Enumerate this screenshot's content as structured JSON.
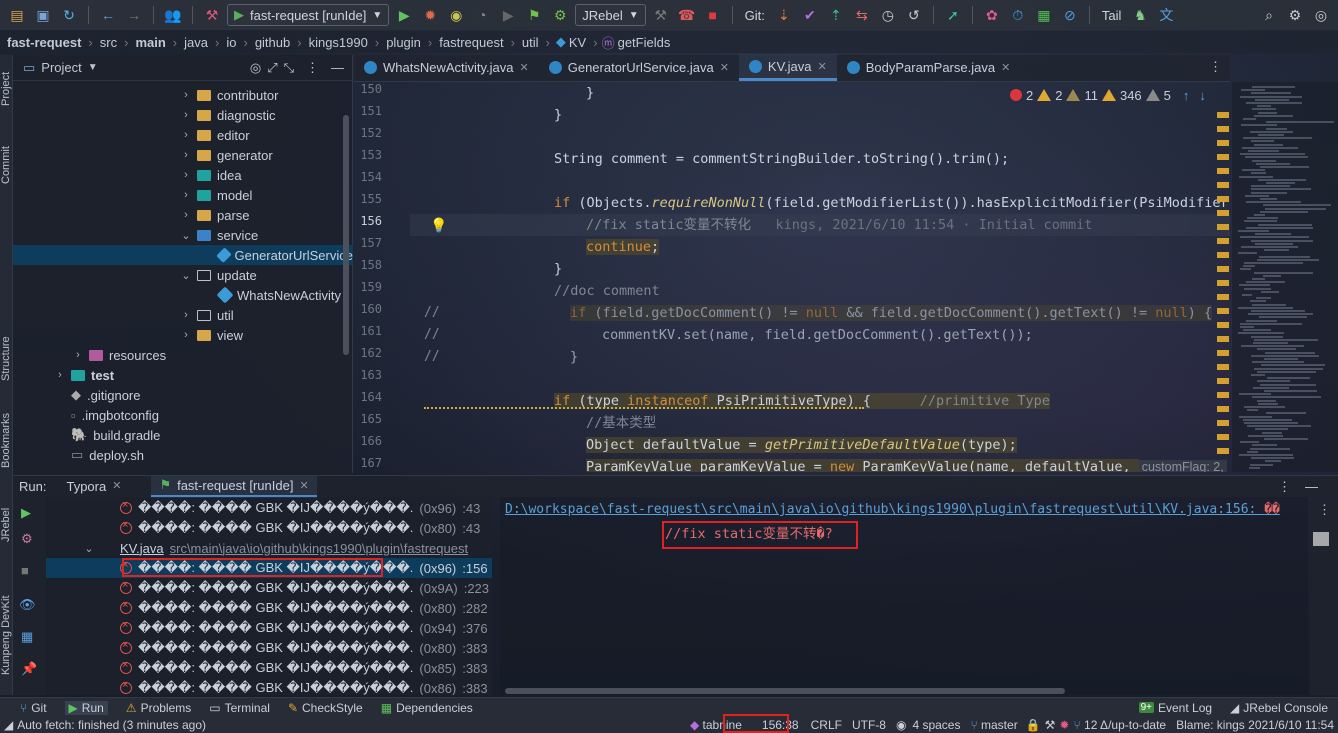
{
  "toolbar": {
    "run_config": "fast-request [runIde]",
    "jrebel": "JRebel",
    "git_label": "Git:",
    "tail_label": "Tail"
  },
  "breadcrumb": [
    "fast-request",
    "src",
    "main",
    "java",
    "io",
    "github",
    "kings1990",
    "plugin",
    "fastrequest",
    "util",
    "KV",
    "getFields"
  ],
  "left_strip": {
    "project": "Project",
    "commit": "Commit",
    "structure": "Structure",
    "bookmarks": "Bookmarks"
  },
  "project_panel": {
    "title": "Project",
    "items": [
      {
        "label": "contributor"
      },
      {
        "label": "diagnostic"
      },
      {
        "label": "editor"
      },
      {
        "label": "generator"
      },
      {
        "label": "idea"
      },
      {
        "label": "model"
      },
      {
        "label": "parse"
      },
      {
        "label": "service"
      },
      {
        "label": "GeneratorUrlService"
      },
      {
        "label": "update"
      },
      {
        "label": "WhatsNewActivity"
      },
      {
        "label": "util"
      },
      {
        "label": "view"
      },
      {
        "label": "resources"
      },
      {
        "label": "test"
      },
      {
        "label": ".gitignore"
      },
      {
        "label": ".imgbotconfig"
      },
      {
        "label": "build.gradle"
      },
      {
        "label": "deploy.sh"
      }
    ]
  },
  "editor": {
    "tabs": [
      "WhatsNewActivity.java",
      "GeneratorUrlService.java",
      "KV.java",
      "BodyParamParse.java"
    ],
    "indicators": {
      "errors": "2",
      "warnings": "2",
      "weak": "11",
      "typos": "346",
      "other": "5"
    },
    "line_numbers": [
      "150",
      "151",
      "152",
      "153",
      "154",
      "155",
      "156",
      "157",
      "158",
      "159",
      "160",
      "161",
      "162",
      "163",
      "164",
      "165",
      "166",
      "167"
    ],
    "lines": [
      {
        "t1": "}"
      },
      {
        "t1": "}"
      },
      {
        "t1": ""
      },
      {
        "t1": "String comment = commentStringBuilder.toString().trim();"
      },
      {
        "t1": ""
      },
      {
        "kw": "if ",
        "t1": "(Objects.",
        "fn": "requireNonNull",
        "t2": "(field.getModifierList()).hasExplicitModifier(PsiModifier."
      },
      {
        "cm": "//fix static变量不转化",
        "blame": "kings, 2021/6/10 11:54 · Initial commit"
      },
      {
        "kw": "continue",
        "t1": ";"
      },
      {
        "t1": "}"
      },
      {
        "cm": "//doc comment"
      },
      {
        "kw": "if ",
        "t1": "(field.getDocComment() != ",
        "kw2": "null",
        "t2": " && field.getDocComment().getText() != ",
        "kw3": "null",
        "t3": ") {"
      },
      {
        "t1": "commentKV.set(name, field.getDocComment().getText());"
      },
      {
        "t1": "}"
      },
      {
        "t1": ""
      },
      {
        "kw": "if ",
        "t1": "(type ",
        "kw2": "instanceof",
        "t2": " PsiPrimitiveType) {",
        "cm": "//primitive Type"
      },
      {
        "cm": "//基本类型"
      },
      {
        "t1": "Object defaultValue = ",
        "fn": "getPrimitiveDefaultValue",
        "t2": "(type);"
      },
      {
        "t1": "ParamKeyValue paramKeyValue = ",
        "kw": "new",
        "t2": " ParamKeyValue(name, defaultValue, ",
        "hint": "customFlag: 2,"
      }
    ],
    "gutter_comments": [
      "//",
      "//",
      "//"
    ]
  },
  "run_panel": {
    "label": "Run:",
    "tabs": [
      "Typora",
      "fast-request [runIde]"
    ],
    "rows": [
      {
        "text": "����: ���� GBK �IJ����ý���.",
        "code": "(0x96)",
        "line": ":43"
      },
      {
        "text": "����: ���� GBK �IJ����ý���.",
        "code": "(0x80)",
        "line": ":43"
      },
      {
        "file": "KV.java",
        "path": "src\\main\\java\\io\\github\\kings1990\\plugin\\fastrequest"
      },
      {
        "text": "����: ���� GBK �IJ����ý���.",
        "code": "(0x96)",
        "line": ":156"
      },
      {
        "text": "����: ���� GBK �IJ����ý���.",
        "code": "(0x9A)",
        "line": ":223"
      },
      {
        "text": "����: ���� GBK �IJ����ý���.",
        "code": "(0x80)",
        "line": ":282"
      },
      {
        "text": "����: ���� GBK �IJ����ý���.",
        "code": "(0x94)",
        "line": ":376"
      },
      {
        "text": "����: ���� GBK �IJ����ý���.",
        "code": "(0x80)",
        "line": ":383"
      },
      {
        "text": "����: ���� GBK �IJ����ý���.",
        "code": "(0x85)",
        "line": ":383"
      },
      {
        "text": "����: ���� GBK �IJ����ý���.",
        "code": "(0x86)",
        "line": ":383"
      }
    ],
    "console_link": "D:\\workspace\\fast-request\\src\\main\\java\\io\\github\\kings1990\\plugin\\fastrequest\\util\\KV.java:156:",
    "console_link_suffix": "��",
    "console_line": "//fix static变量不转�?"
  },
  "bottom_tabs": [
    "Git",
    "Run",
    "Problems",
    "Terminal",
    "CheckStyle",
    "Dependencies"
  ],
  "bottom_right": [
    "Event Log",
    "JRebel Console"
  ],
  "event_log_badge": "9+",
  "status": {
    "left": "Auto fetch: finished (3 minutes ago)",
    "tabnine": "tabnine",
    "position": "156:38",
    "line_sep": "CRLF",
    "encoding": "UTF-8",
    "indent": "4 spaces",
    "branch": "master",
    "sync": "12 Δ/up-to-date",
    "blame": "Blame: kings 2021/6/10 11:54"
  }
}
